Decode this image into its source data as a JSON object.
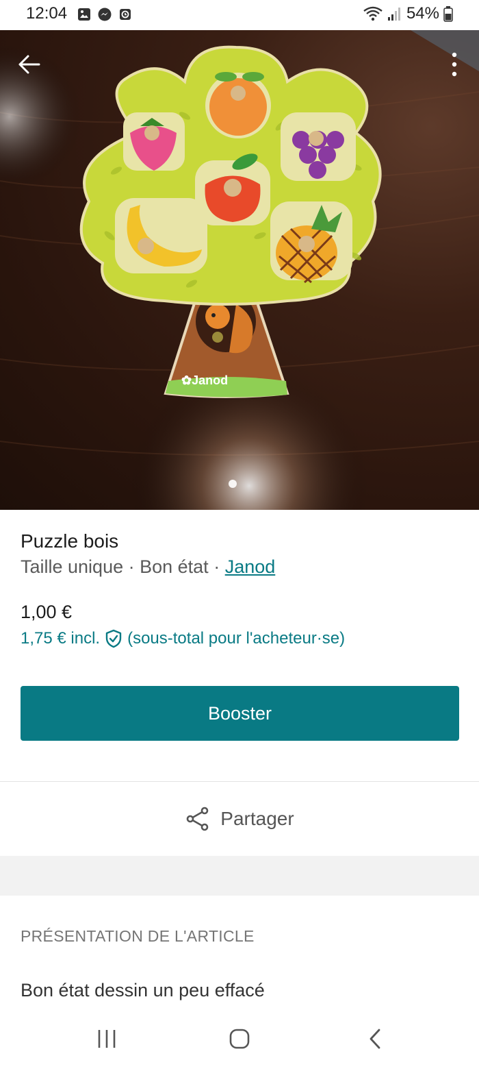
{
  "status_bar": {
    "time": "12:04",
    "battery": "54%",
    "icons_left": [
      "gallery-icon",
      "messenger-icon",
      "alarm-icon"
    ],
    "icons_right": [
      "wifi-icon",
      "signal-icon",
      "battery-icon"
    ]
  },
  "photo": {
    "brand_on_toy": "Janod",
    "page_indicator": {
      "current": 1,
      "total": 1
    }
  },
  "item": {
    "title": "Puzzle bois",
    "size": "Taille unique",
    "separator": " · ",
    "condition": "Bon état",
    "brand": "Janod",
    "price": "1,00 €",
    "price_incl": "1,75 € incl.",
    "price_incl_note": "(sous-total pour l'acheteur·se)"
  },
  "actions": {
    "booster_label": "Booster",
    "share_label": "Partager"
  },
  "section": {
    "header": "PRÉSENTATION DE L'ARTICLE",
    "description": "Bon état dessin un peu effacé"
  },
  "colors": {
    "accent": "#097a84",
    "text": "#1c1c1c",
    "muted": "#5a5a5a",
    "band": "#f2f2f2"
  }
}
